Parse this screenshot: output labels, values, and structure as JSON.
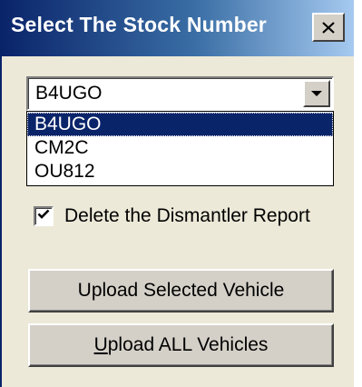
{
  "window": {
    "title": "Select The Stock Number",
    "close_icon": "close-icon"
  },
  "stock_combo": {
    "selected_value": "B4UGO",
    "dropdown_icon": "chevron-down-icon"
  },
  "stock_list": {
    "items": [
      "B4UGO",
      "CM2C",
      "OU812"
    ],
    "selected_index": 0
  },
  "delete_report": {
    "label": "Delete the Dismantler Report",
    "checked": true
  },
  "buttons": {
    "upload_selected": "Upload Selected Vehicle",
    "upload_all_mnemonic": "U",
    "upload_all_rest": "pload ALL Vehicles"
  },
  "colors": {
    "title_bar_start": "#0a246a",
    "title_bar_end": "#a6caf0",
    "dialog_background": "#ece9d8",
    "selection": "#0a246a"
  }
}
